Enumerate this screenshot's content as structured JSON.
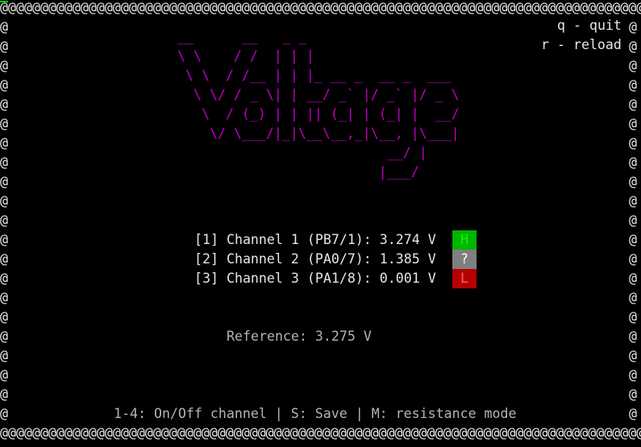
{
  "border": {
    "top": "@@@@@@@@@@@@@@@@@@@@@@@@@@@@@@@@@@@@@@@@@@@@@@@@@@@@@@@@@@@@@@@@@@@@@@@@@@@@@@@@",
    "bottom": "@@@@@@@@@@@@@@@@@@@@@@@@@@@@@@@@@@@@@@@@@@@@@@@@@@@@@@@@@@@@@@@@@@@@@@@@@@@@@@@@",
    "side": "@"
  },
  "hints": {
    "quit": "q - quit",
    "reload": "r - reload"
  },
  "banner": "__      __   _ _\n\\ \\    / /  | | |\n \\ \\  / /__ | | |_ __ _  __ _  ___\n  \\ \\/ / _ \\| | __/ _` |/ _` |/ _ \\\n   \\  / (_) | | || (_| | (_| |  __/\n    \\/ \\___/|_|\\__\\__,_|\\__, |\\___|\n                          __/ |\n                         |___/",
  "channels": [
    {
      "text": "[1] Channel 1 (PB7/1): 3.274 V",
      "badge": "H",
      "badge_bg": "#00b400",
      "badge_fg": "#00ff00"
    },
    {
      "text": "[2] Channel 2 (PA0/7): 1.385 V",
      "badge": "?",
      "badge_bg": "#7f7f7f",
      "badge_fg": "#ffffff"
    },
    {
      "text": "[3] Channel 3 (PA1/8): 0.001 V",
      "badge": "L",
      "badge_bg": "#b40000",
      "badge_fg": "#ff6060"
    }
  ],
  "reference": "Reference: 3.275 V",
  "footer": "1-4: On/Off channel | S: Save | M: resistance mode",
  "colors": {
    "banner": "#c000c0",
    "background": "#000000",
    "text": "#e6e6e6",
    "muted": "#b4b4b4",
    "cursor": "#00cc00"
  }
}
